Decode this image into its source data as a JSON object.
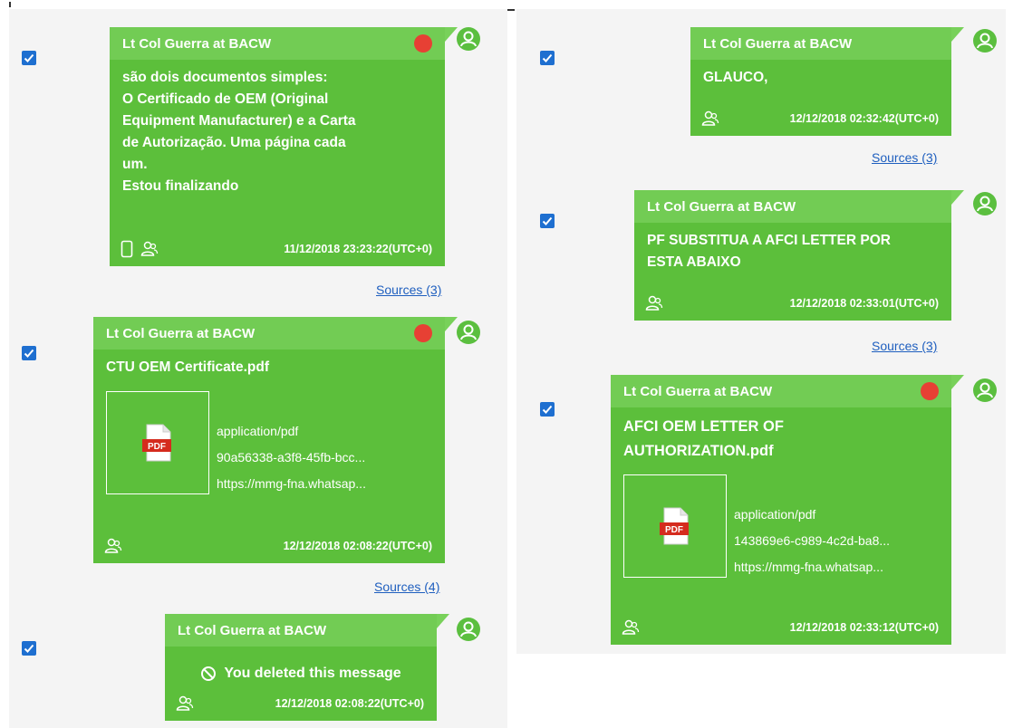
{
  "sender": "Lt Col Guerra at BACW",
  "colors": {
    "bubble": "#5cbf3b",
    "bubble_header": "#72cc54",
    "unread_dot": "#e74034",
    "checkbox": "#1e6fd0",
    "link": "#1f5fbf",
    "panel_bg": "#f4f4f4"
  },
  "left_column": {
    "messages": [
      {
        "sender": "Lt Col Guerra at BACW",
        "unread_dot": true,
        "checked": true,
        "lines": [
          "são dois documentos simples:",
          "O Certificado de OEM (Original",
          "Equipment Manufacturer) e a Carta",
          "de Autorização. Uma página cada",
          "um.",
          "Estou finalizando"
        ],
        "footer_icons": [
          "phone-icon",
          "contacts-icon"
        ],
        "timestamp": "11/12/2018 23:23:22(UTC+0)",
        "sources": "Sources (3)"
      },
      {
        "sender": "Lt Col Guerra at BACW",
        "unread_dot": true,
        "checked": true,
        "filename": "CTU OEM Certificate.pdf",
        "attachment": {
          "icon": "pdf-file-icon",
          "icon_label": "PDF",
          "mime": "application/pdf",
          "id": "90a56338-a3f8-45fb-bcc...",
          "url": "https://mmg-fna.whatsap..."
        },
        "footer_icons": [
          "contacts-icon"
        ],
        "timestamp": "12/12/2018 02:08:22(UTC+0)",
        "sources": "Sources (4)"
      },
      {
        "sender": "Lt Col Guerra at BACW",
        "unread_dot": false,
        "checked": true,
        "deleted_text": "You deleted this message",
        "footer_icons": [
          "contacts-icon"
        ],
        "timestamp": "12/12/2018 02:08:22(UTC+0)"
      }
    ]
  },
  "right_column": {
    "messages": [
      {
        "sender": "Lt Col Guerra at BACW",
        "unread_dot": false,
        "checked": true,
        "lines": [
          "GLAUCO,"
        ],
        "footer_icons": [
          "contacts-icon"
        ],
        "timestamp": "12/12/2018 02:32:42(UTC+0)",
        "sources": "Sources (3)"
      },
      {
        "sender": "Lt Col Guerra at BACW",
        "unread_dot": false,
        "checked": true,
        "lines": [
          "PF SUBSTITUA A AFCI LETTER POR",
          "ESTA ABAIXO"
        ],
        "footer_icons": [
          "contacts-icon"
        ],
        "timestamp": "12/12/2018 02:33:01(UTC+0)",
        "sources": "Sources (3)"
      },
      {
        "sender": "Lt Col Guerra at BACW",
        "unread_dot": true,
        "checked": true,
        "filename_lines": [
          "AFCI OEM LETTER OF",
          "AUTHORIZATION.pdf"
        ],
        "attachment": {
          "icon": "pdf-file-icon",
          "icon_label": "PDF",
          "mime": "application/pdf",
          "id": "143869e6-c989-4c2d-ba8...",
          "url": "https://mmg-fna.whatsap..."
        },
        "footer_icons": [
          "contacts-icon"
        ],
        "timestamp": "12/12/2018 02:33:12(UTC+0)"
      }
    ]
  }
}
